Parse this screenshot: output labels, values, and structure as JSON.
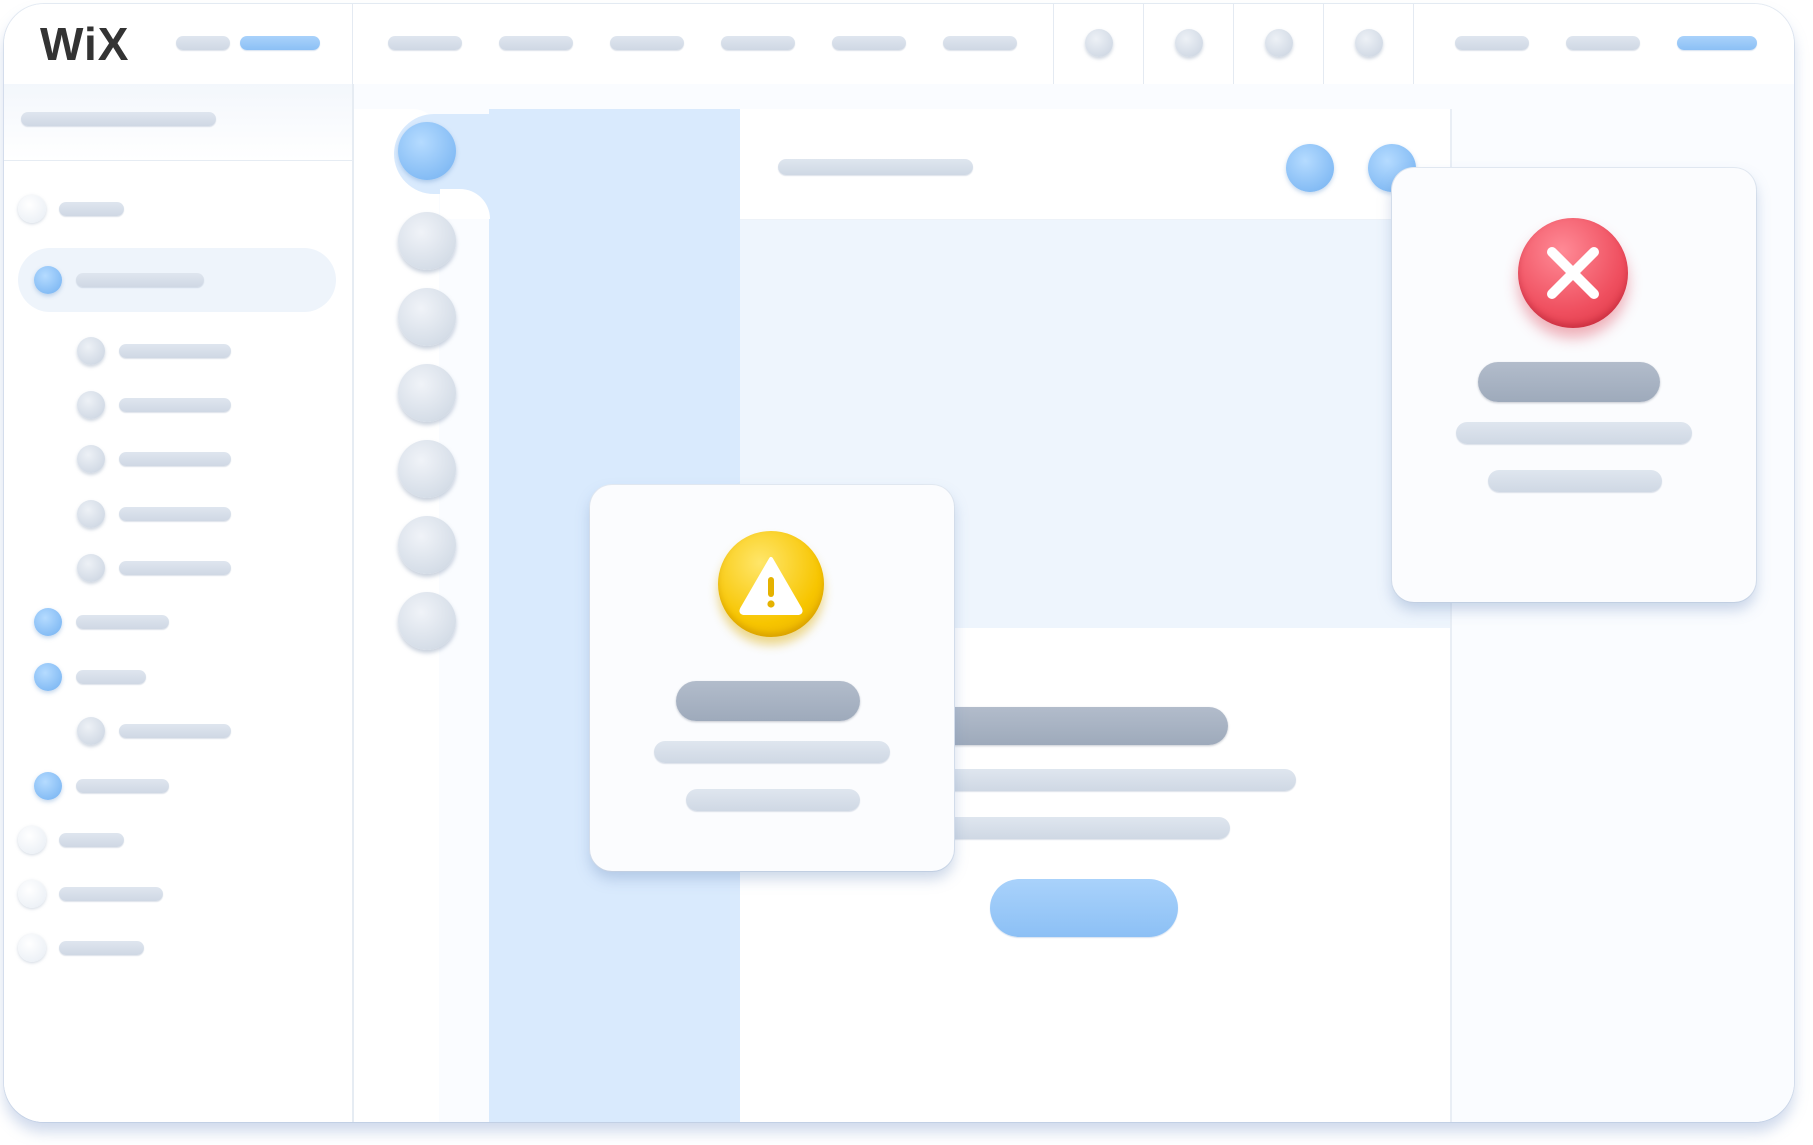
{
  "brand": {
    "logo_text": "WiX",
    "logo_color": "#333333"
  },
  "colors": {
    "accent_blue": "#8cc0f5",
    "panel_blue": "#d9eafd",
    "placeholder_grey": "#cfd8e4",
    "warning_yellow": "#f7c500",
    "error_red": "#ef4f5f"
  },
  "icons": {
    "warning": "warning-triangle-icon",
    "error": "close-x-icon"
  },
  "dialogs": {
    "warning": {
      "severity": "warning"
    },
    "error": {
      "severity": "error"
    }
  }
}
